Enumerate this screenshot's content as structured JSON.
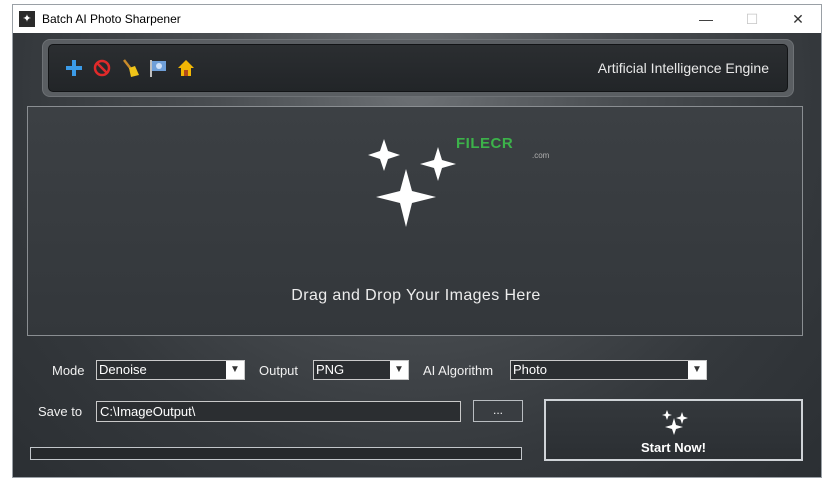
{
  "window": {
    "title": "Batch AI Photo Sharpener",
    "minimize_glyph": "—",
    "maximize_glyph": "☐",
    "close_glyph": "✕"
  },
  "toolbar": {
    "icons": [
      "add-icon",
      "remove-icon",
      "clear-broom-icon",
      "flag-icon",
      "home-icon"
    ],
    "engine_label": "Artificial Intelligence Engine"
  },
  "dropzone": {
    "prompt": "Drag and Drop Your Images Here",
    "watermark_brand": "FILECR",
    "watermark_domain": ".com"
  },
  "controls": {
    "mode_label": "Mode",
    "mode_value": "Denoise",
    "output_label": "Output",
    "output_value": "PNG",
    "algorithm_label": "AI Algorithm",
    "algorithm_value": "Photo",
    "save_label": "Save to",
    "save_path": "C:\\ImageOutput\\",
    "browse_label": "...",
    "start_label": "Start Now!",
    "progress": 0
  },
  "colors": {
    "accent_green": "#3cb24a",
    "panel_dark": "#2b2e31"
  }
}
